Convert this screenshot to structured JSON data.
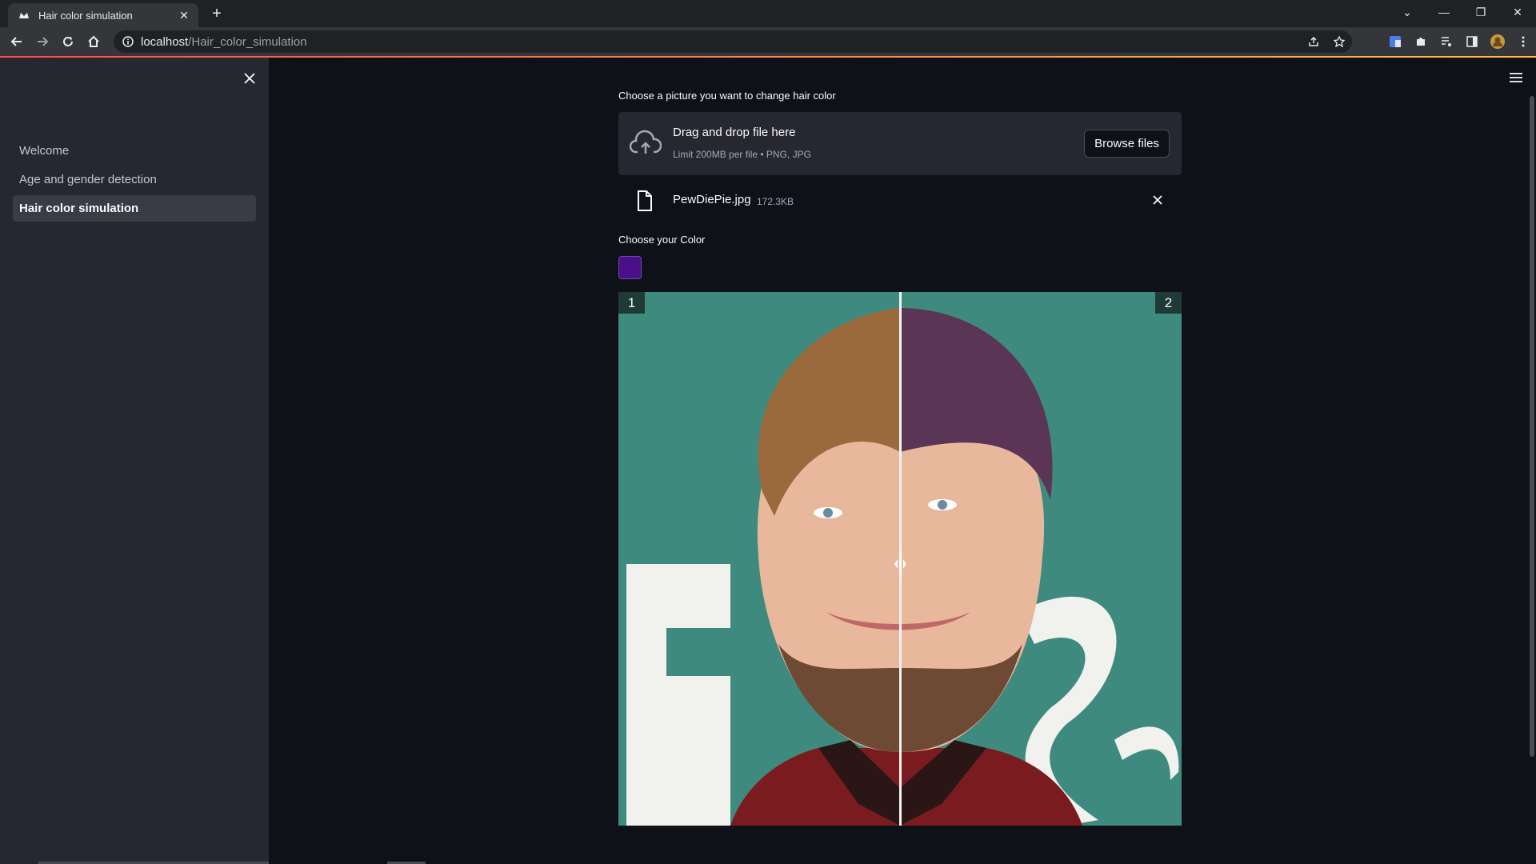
{
  "browser": {
    "tab_title": "Hair color simulation",
    "url_host": "localhost",
    "url_path": "/Hair_color_simulation"
  },
  "sidebar": {
    "items": [
      {
        "label": "Welcome",
        "active": false
      },
      {
        "label": "Age and gender detection",
        "active": false
      },
      {
        "label": "Hair color simulation",
        "active": true
      }
    ]
  },
  "uploader": {
    "label": "Choose a picture you want to change hair color",
    "drop_title": "Drag and drop file here",
    "drop_limits": "Limit 200MB per file • PNG, JPG",
    "browse_label": "Browse files"
  },
  "file": {
    "name": "PewDiePie.jpg",
    "size": "172.3KB"
  },
  "color_picker": {
    "label": "Choose your Color",
    "value": "#4b0f8c"
  },
  "comparison": {
    "left_label": "1",
    "right_label": "2",
    "split": 0.5
  },
  "colors": {
    "background": "#0e1117",
    "sidebar": "#262730",
    "accent_start": "#ff4b4b",
    "accent_end": "#ffbd45"
  }
}
